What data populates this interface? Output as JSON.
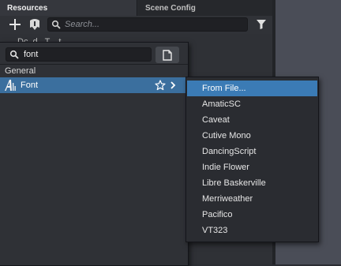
{
  "tabs": {
    "resources": "Resources",
    "scene_config": "Scene Config"
  },
  "toolbar": {
    "search_placeholder": "Search...",
    "add_icon": "plus-icon",
    "import_icon": "import-icon",
    "filter_icon": "filter-icon"
  },
  "background_list": {
    "partial_row": "Dc..d.. T....t"
  },
  "popup": {
    "search_value": "font",
    "category": "General",
    "selected_item": {
      "label": "Font",
      "icon": "font-icon"
    }
  },
  "submenu": {
    "items": [
      "From File...",
      "AmaticSC",
      "Caveat",
      "Cutive Mono",
      "DancingScript",
      "Indie Flower",
      "Libre Baskerville",
      "Merriweather",
      "Pacifico",
      "VT323"
    ]
  },
  "colors": {
    "selection": "#3b6f9e",
    "menu_highlight": "#3b7bb5",
    "panel": "#2f3136"
  }
}
